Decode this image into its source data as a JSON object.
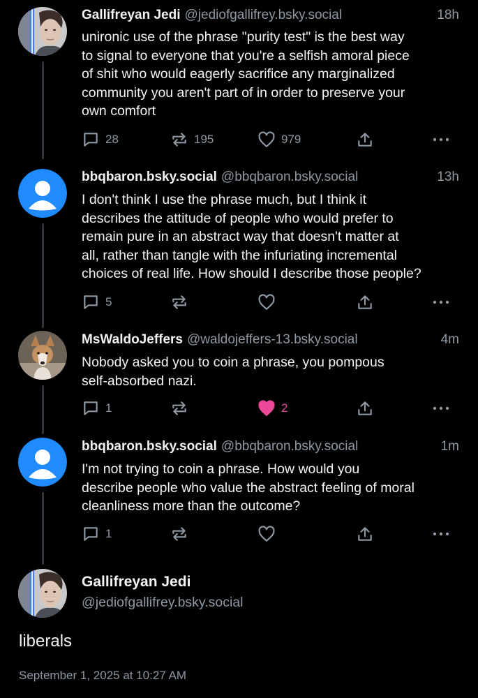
{
  "colors": {
    "background": "#000000",
    "text_primary": "#f1f3f5",
    "text_secondary": "#8e98a3",
    "thread_line": "#2e3439",
    "like_active": "#ec4899",
    "default_avatar": "#208bfe"
  },
  "posts": [
    {
      "author_name": "Gallifreyan Jedi",
      "handle": "@jediofgallifrey.bsky.social",
      "time": "18h",
      "text": "unironic use of the phrase \"purity test\" is the best way\nto signal to everyone that you're a selfish amoral piece\nof shit who would eagerly sacrifice any marginalized\ncommunity you aren't part of in order to preserve your\nown comfort",
      "reply_count": "28",
      "repost_count": "195",
      "like_count": "979",
      "liked": false,
      "avatar_icon": "photo-avatar-man-lightsaber"
    },
    {
      "author_name": "bbqbaron.bsky.social",
      "handle": "@bbqbaron.bsky.social",
      "time": "13h",
      "text": "I don't think I use the phrase much, but I think it\ndescribes the attitude of people who would prefer to\nremain pure in an abstract way that doesn't matter at\nall, rather than tangle with the infuriating incremental\nchoices of real life. How should I describe those people?",
      "reply_count": "5",
      "repost_count": "",
      "like_count": "",
      "liked": false,
      "avatar_icon": "default-user-icon"
    },
    {
      "author_name": "MsWaldoJeffers",
      "handle": "@waldojeffers-13.bsky.social",
      "time": "4m",
      "text": "Nobody asked you to coin a phrase, you pompous\nself-absorbed nazi.",
      "reply_count": "1",
      "repost_count": "",
      "like_count": "2",
      "liked": true,
      "avatar_icon": "photo-avatar-dog"
    },
    {
      "author_name": "bbqbaron.bsky.social",
      "handle": "@bbqbaron.bsky.social",
      "time": "1m",
      "text": "I'm not trying to coin a phrase. How would you\ndescribe people who value the abstract feeling of moral\ncleanliness more than the outcome?",
      "reply_count": "1",
      "repost_count": "",
      "like_count": "",
      "liked": false,
      "avatar_icon": "default-user-icon"
    }
  ],
  "focus_post": {
    "author_name": "Gallifreyan Jedi",
    "handle": "@jediofgallifrey.bsky.social",
    "text": "liberals",
    "timestamp": "September 1, 2025 at 10:27 AM",
    "avatar_icon": "photo-avatar-man-lightsaber"
  }
}
